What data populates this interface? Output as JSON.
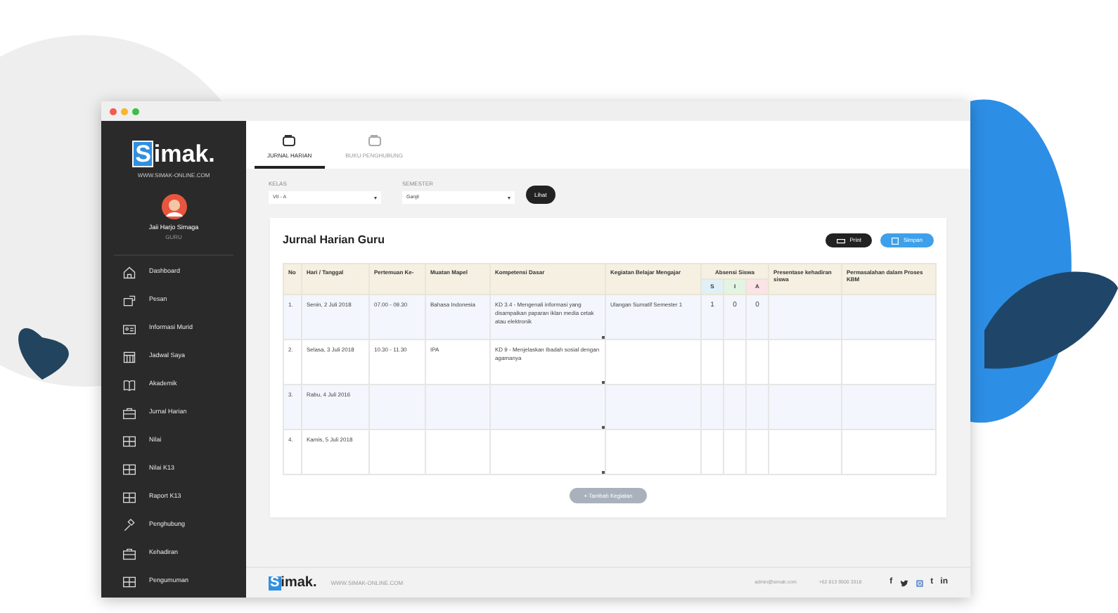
{
  "sidebar": {
    "logo": "Simak.",
    "logo_url": "WWW.SIMAK-ONLINE.COM",
    "user": {
      "name": "Jaii Harjo Simaga",
      "role": "GURU"
    },
    "items": [
      {
        "label": "Dashboard"
      },
      {
        "label": "Pesan"
      },
      {
        "label": "Informasi Murid"
      },
      {
        "label": "Jadwal Saya"
      },
      {
        "label": "Akademik"
      },
      {
        "label": "Jurnal Harian"
      },
      {
        "label": "Nilai"
      },
      {
        "label": "Nilai K13"
      },
      {
        "label": "Raport K13"
      },
      {
        "label": "Penghubung"
      },
      {
        "label": "Kehadiran"
      },
      {
        "label": "Pengumuman"
      }
    ]
  },
  "tabs": [
    {
      "label": "JURNAL HARIAN",
      "selected": true
    },
    {
      "label": "BUKU PENGHUBUNG",
      "selected": false
    }
  ],
  "filters": [
    {
      "label": "KELAS",
      "value": "VII - A"
    },
    {
      "label": "SEMESTER",
      "value": "Ganjil"
    }
  ],
  "filter_button": "Lihat",
  "card": {
    "title": "Jurnal Harian Guru",
    "print_button": "Print",
    "save_button": "Simpan",
    "table": {
      "columns": [
        "No",
        "Hari / Tanggal",
        "Pertemuan Ke-",
        "Muatan Mapel",
        "Kompetensi Dasar",
        "Kegiatan Belajar Mengajar",
        "Absensi Siswa",
        "Presentase kehadiran siswa",
        "Permasalahan dalam Proses KBM"
      ],
      "absensi_columns": [
        "S",
        "I",
        "A"
      ],
      "rows": [
        {
          "no": "1.",
          "date": "Senin, 2 Juli 2018",
          "meeting": "07.00 - 09.30",
          "subject": "Bahasa Indonesia",
          "competency": "KD 3.4 - Mengenali informasi yang disampaikan paparan iklan media cetak atau elektronik",
          "activity": "Ulangan Sumatif Semester 1",
          "absensi": [
            "1",
            "0",
            "0"
          ]
        },
        {
          "no": "2.",
          "date": "Selasa, 3 Juli 2018",
          "meeting": "10.30 - 11.30",
          "subject": "IPA",
          "competency": "KD 9 - Menjelaskan Ibadah sosial dengan agamanya"
        },
        {
          "no": "3.",
          "date": "Rabu, 4 Juli 2016"
        },
        {
          "no": "4.",
          "date": "Kamis, 5 Juli 2018"
        }
      ]
    },
    "add_button": {
      "label": "+ Tambah Kegiatan",
      "disabled": true
    }
  },
  "footer": {
    "logo": "Simak.",
    "url": "WWW.SIMAK-ONLINE.COM",
    "email": "admin@simak.com",
    "phone": "+62 813 9500 3318",
    "social": [
      {
        "kind": "facebook",
        "label": "f"
      },
      {
        "kind": "twitter"
      },
      {
        "kind": "instagram"
      },
      {
        "kind": "tumblr",
        "label": "t"
      },
      {
        "kind": "linkedin",
        "label": "in"
      }
    ]
  }
}
